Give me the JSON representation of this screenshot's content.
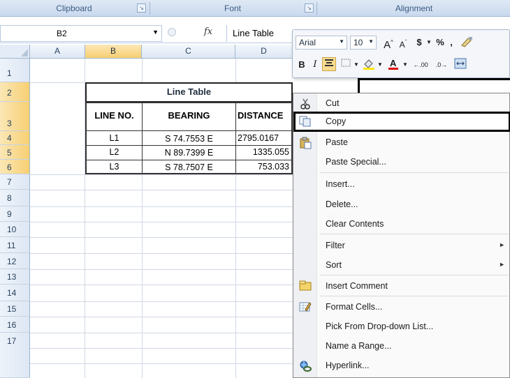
{
  "ribbon": {
    "groups": [
      {
        "label": "Clipboard"
      },
      {
        "label": "Font"
      },
      {
        "label": "Alignment"
      }
    ],
    "launcher_glyph": "↘"
  },
  "formula_bar": {
    "name_box": "B2",
    "fx_label": "fx",
    "formula": "Line Table"
  },
  "columns": [
    "A",
    "B",
    "C",
    "D"
  ],
  "rows": [
    "1",
    "2",
    "3",
    "4",
    "5",
    "6",
    "7",
    "8",
    "9",
    "10",
    "11",
    "12",
    "13",
    "14",
    "15",
    "16",
    "17"
  ],
  "table": {
    "title": "Line Table",
    "headers": [
      "LINE NO.",
      "BEARING",
      "DISTANCE"
    ],
    "data": [
      {
        "line": "L1",
        "bearing": "S 74.7553 E",
        "distance": "2795.0167"
      },
      {
        "line": "L2",
        "bearing": "N 89.7399 E",
        "distance": "1335.055"
      },
      {
        "line": "L3",
        "bearing": "S 78.7507 E",
        "distance": "753.033"
      }
    ]
  },
  "mini_toolbar": {
    "font": "Arial",
    "size": "10",
    "bold": "B",
    "italic": "I",
    "grow_font": "A",
    "shrink_font": "A",
    "currency": "$",
    "percent": "%",
    "comma": ",",
    "inc_decimal": ".00",
    "dec_decimal": ".0"
  },
  "context_menu": {
    "items": [
      {
        "label": "Cut",
        "icon": "scissors-icon"
      },
      {
        "label": "Copy",
        "icon": "copy-icon"
      },
      {
        "label": "Paste",
        "icon": "paste-icon"
      },
      {
        "label": "Paste Special..."
      },
      {
        "label": "Insert..."
      },
      {
        "label": "Delete..."
      },
      {
        "label": "Clear Contents"
      },
      {
        "label": "Filter",
        "submenu": true
      },
      {
        "label": "Sort",
        "submenu": true
      },
      {
        "label": "Insert Comment",
        "icon": "comment-icon"
      },
      {
        "label": "Format Cells...",
        "icon": "format-cells-icon"
      },
      {
        "label": "Pick From Drop-down List..."
      },
      {
        "label": "Name a Range..."
      },
      {
        "label": "Hyperlink...",
        "icon": "hyperlink-icon"
      }
    ],
    "submenu_arrow": "►",
    "highlighted": "Copy"
  },
  "colors": {
    "selection_header": "#f7cf73",
    "grid_line": "#d0d7e5",
    "ribbon_bg": "#dfe9f5"
  }
}
